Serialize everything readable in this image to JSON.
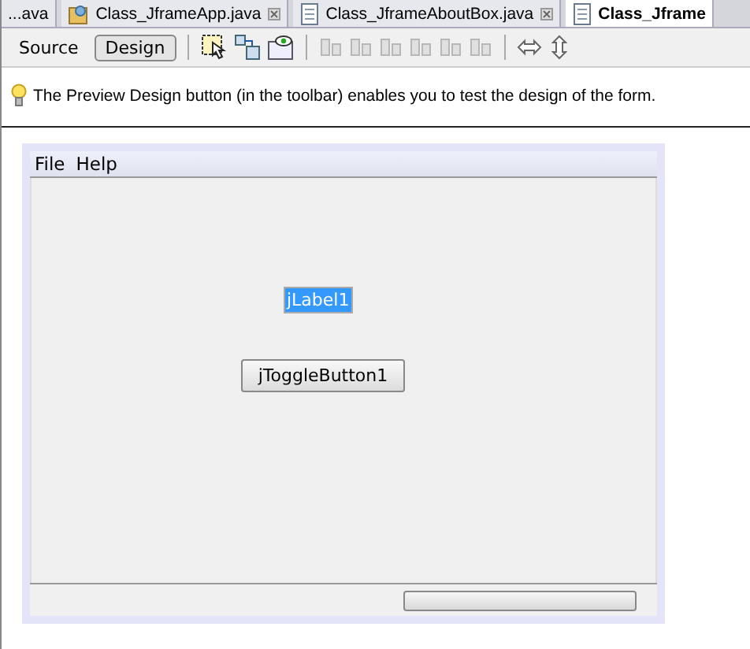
{
  "tabs": [
    {
      "label": "...ava",
      "selected": false,
      "closable": false,
      "kind": "plain"
    },
    {
      "label": "Class_JframeApp.java",
      "selected": false,
      "closable": true,
      "kind": "app"
    },
    {
      "label": "Class_JframeAboutBox.java",
      "selected": false,
      "closable": true,
      "kind": "doc"
    },
    {
      "label": "Class_Jframe",
      "selected": true,
      "closable": false,
      "kind": "doc"
    }
  ],
  "view_buttons": [
    {
      "label": "Source",
      "selected": false
    },
    {
      "label": "Design",
      "selected": true
    }
  ],
  "hint": "The Preview Design button (in the toolbar) enables you to test the design of the form.",
  "form": {
    "menu": [
      "File",
      "Help"
    ],
    "label": "jLabel1",
    "label_selected": true,
    "toggle_button": "jToggleButton1",
    "progress": {
      "level": 0
    }
  }
}
